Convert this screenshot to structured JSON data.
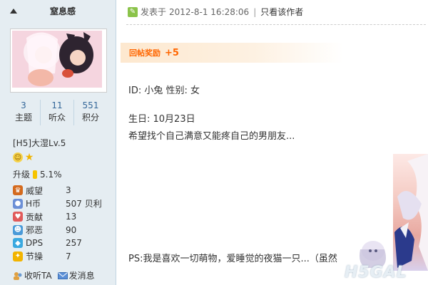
{
  "sidebar": {
    "username": "窒息感",
    "stats": [
      {
        "value": "3",
        "label": "主题"
      },
      {
        "value": "11",
        "label": "听众"
      },
      {
        "value": "551",
        "label": "积分"
      }
    ],
    "level": "[H5]大湿Lv.5",
    "upgrade_label": "升级",
    "upgrade_value": "5.1%",
    "props": [
      {
        "icon": "crown-icon",
        "label": "威望",
        "value": "3"
      },
      {
        "icon": "coin-icon",
        "label": "H币",
        "value": "507 贝利"
      },
      {
        "icon": "heart-icon",
        "label": "贡献",
        "value": "13"
      },
      {
        "icon": "devil-icon",
        "label": "邪恶",
        "value": "90"
      },
      {
        "icon": "gem-icon",
        "label": "DPS",
        "value": "257"
      },
      {
        "icon": "bulb-icon",
        "label": "节操",
        "value": "7"
      }
    ],
    "actions": {
      "follow": "收听TA",
      "message": "发消息"
    }
  },
  "post": {
    "posted_prefix": "发表于",
    "posted_time": "2012-8-1 16:28:06",
    "separator": "|",
    "only_author": "只看该作者",
    "reward_label": "回帖奖励",
    "reward_value": "+5",
    "lines": [
      "ID: 小兔    性别: 女",
      "生日: 10月23日",
      "希望找个自己满意又能疼自己的男朋友...",
      "PS:我是喜欢一切萌物，爱睡觉的夜猫一只...（虽然"
    ],
    "watermark": "H5GAL"
  },
  "colors": {
    "sidebar_bg": "#e5edf2",
    "link": "#336699",
    "reward": "#ff6600"
  }
}
